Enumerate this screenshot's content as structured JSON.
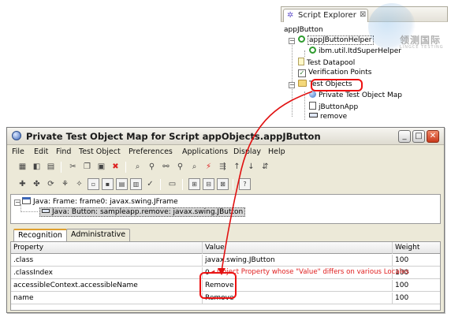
{
  "explorer": {
    "tab_title": "Script Explorer",
    "tab_close": "⊠",
    "root": "appJButton",
    "items": [
      {
        "label": "appJButtonHelper"
      },
      {
        "label": "ibm.util.ItdSuperHelper"
      },
      {
        "label": "Test Datapool"
      },
      {
        "label": "Verification Points"
      },
      {
        "label": "Test Objects"
      },
      {
        "label": "Private Test Object Map"
      },
      {
        "label": "jButtonApp"
      },
      {
        "label": "remove"
      }
    ]
  },
  "watermark": {
    "text": "领测国际",
    "sub": "LINGCE TESTING"
  },
  "window": {
    "title": "Private Test Object Map for Script appObjects.appJButton",
    "menu": [
      "File",
      "Edit",
      "Find",
      "Test Object",
      "Preferences",
      "Applications",
      "Display",
      "Help"
    ]
  },
  "objtree": {
    "frame": "Java: Frame: frame0: javax.swing.JFrame",
    "button": "Java: Button: sampleapp.remove: javax.swing.JButton"
  },
  "tabs": [
    "Recognition",
    "Administrative"
  ],
  "grid": {
    "headers": [
      "Property",
      "Value",
      "Weight"
    ],
    "rows": [
      {
        "property": ".class",
        "value": "javax.swing.JButton",
        "weight": "100"
      },
      {
        "property": ".classIndex",
        "value": "0",
        "weight": "100"
      },
      {
        "property": "accessibleContext.accessibleName",
        "value": "Remove",
        "weight": "100"
      },
      {
        "property": "name",
        "value": "Remove",
        "weight": "100"
      }
    ]
  },
  "annotation": "Object Property whose \"Value\" differs on various Locales",
  "colors": {
    "annotation": "#e11111",
    "window_bg": "#ece9d8"
  }
}
